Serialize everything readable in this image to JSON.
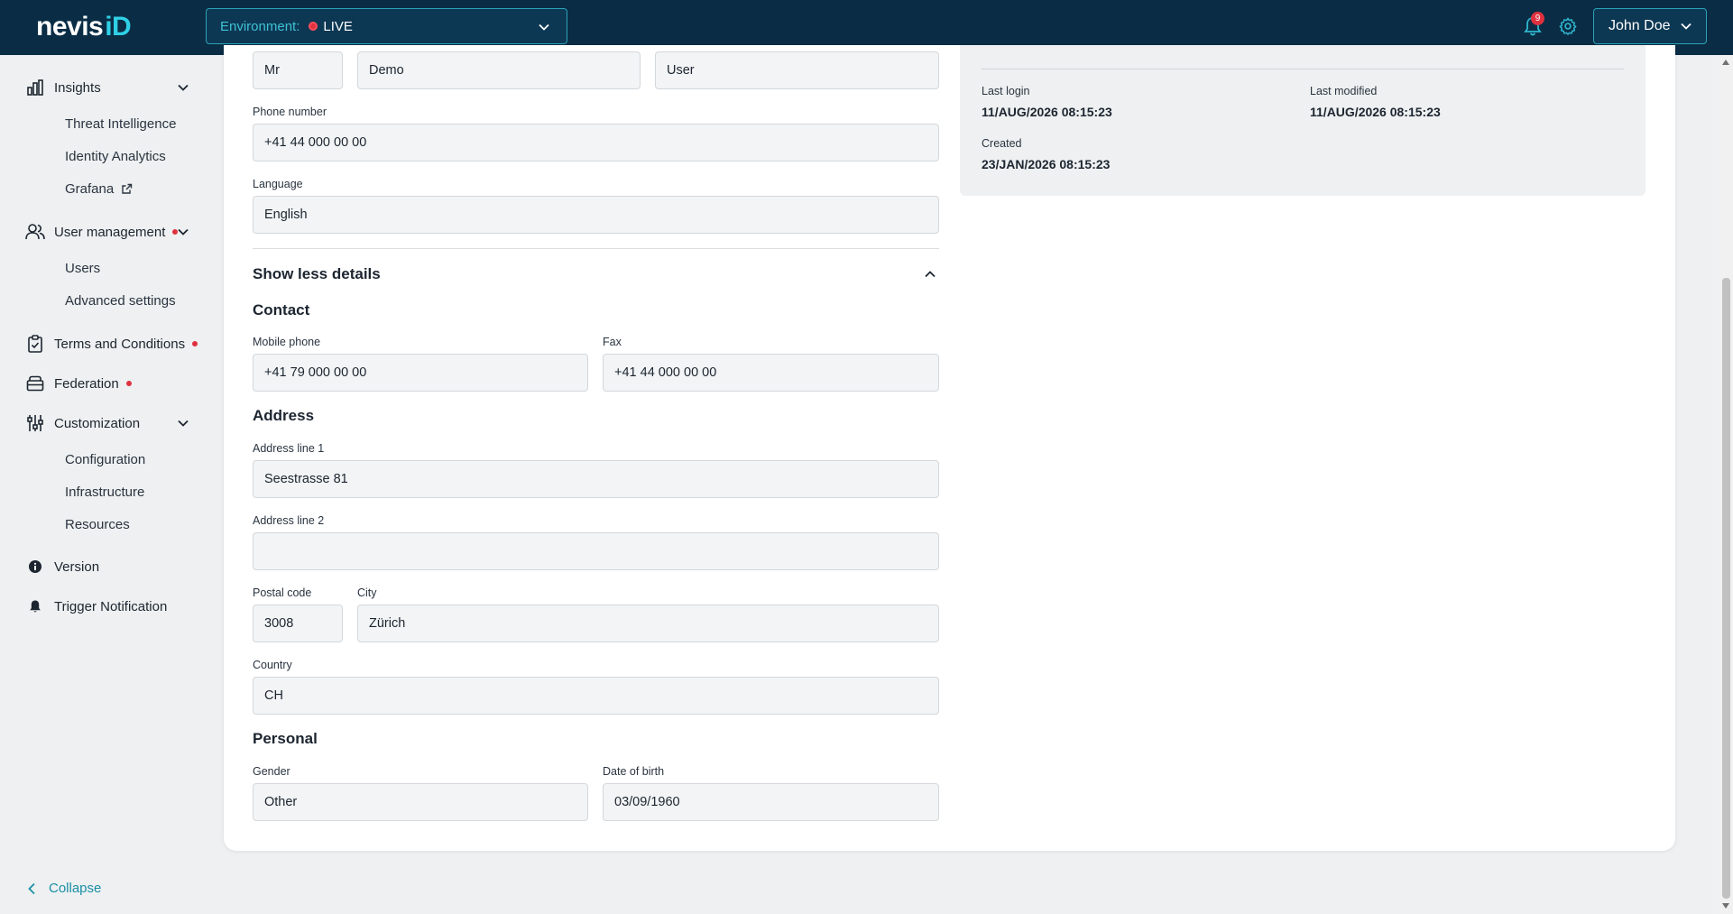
{
  "header": {
    "logo_main": "nevis",
    "logo_accent": "iD",
    "environment_label": "Environment:",
    "environment_value": "LIVE",
    "notification_count": "9",
    "user_name": "John Doe"
  },
  "sidebar": {
    "insights": "Insights",
    "threat_intelligence": "Threat Intelligence",
    "identity_analytics": "Identity Analytics",
    "grafana": "Grafana",
    "user_management": "User management",
    "users": "Users",
    "advanced_settings": "Advanced settings",
    "terms": "Terms and Conditions",
    "federation": "Federation",
    "customization": "Customization",
    "configuration": "Configuration",
    "infrastructure": "Infrastructure",
    "resources": "Resources",
    "version": "Version",
    "trigger_notification": "Trigger Notification",
    "collapse": "Collapse"
  },
  "form": {
    "title_value": "Mr",
    "first_name_value": "Demo",
    "last_name_value": "User",
    "phone_label": "Phone number",
    "phone_value": "+41 44 000 00 00",
    "language_label": "Language",
    "language_value": "English",
    "toggle_details": "Show less details",
    "contact_title": "Contact",
    "mobile_label": "Mobile phone",
    "mobile_value": "+41 79 000 00 00",
    "fax_label": "Fax",
    "fax_value": "+41 44 000 00 00",
    "address_title": "Address",
    "address1_label": "Address line 1",
    "address1_value": "Seestrasse 81",
    "address2_label": "Address line 2",
    "address2_value": "",
    "postal_label": "Postal code",
    "postal_value": "3008",
    "city_label": "City",
    "city_value": "Zürich",
    "country_label": "Country",
    "country_value": "CH",
    "personal_title": "Personal",
    "gender_label": "Gender",
    "gender_value": "Other",
    "dob_label": "Date of birth",
    "dob_value": "03/09/1960"
  },
  "info": {
    "last_login_label": "Last login",
    "last_login_value": "11/AUG/2026 08:15:23",
    "last_modified_label": "Last modified",
    "last_modified_value": "11/AUG/2026 08:15:23",
    "created_label": "Created",
    "created_value": "23/JAN/2026 08:15:23"
  },
  "colors": {
    "topbar": "#0a2d45",
    "accent": "#2fd0e6",
    "link": "#1a8fa6",
    "alert": "#e0313f"
  }
}
